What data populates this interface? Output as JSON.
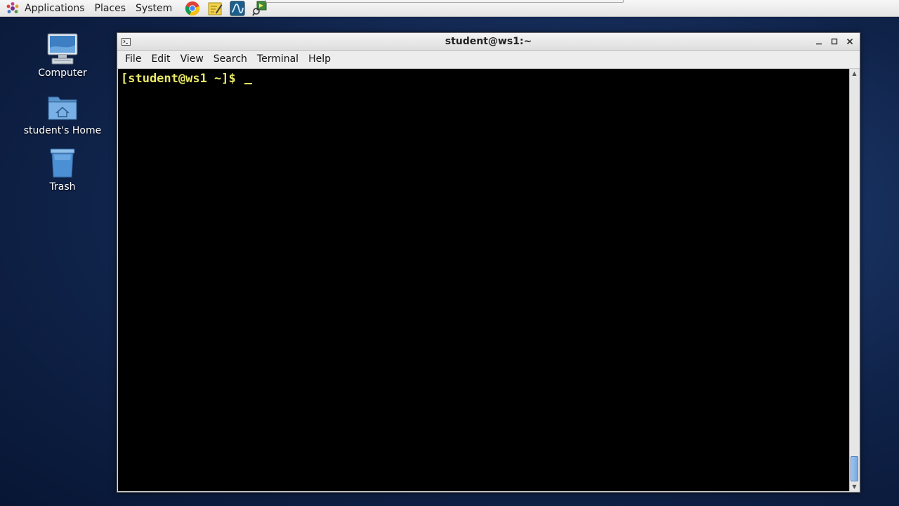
{
  "top_panel": {
    "menus": [
      "Applications",
      "Places",
      "System"
    ],
    "launchers": [
      "chrome-icon",
      "text-editor-icon",
      "oscilloscope-icon",
      "network-tool-icon"
    ]
  },
  "desktop": {
    "icons": [
      {
        "label": "Computer",
        "icon": "computer-icon"
      },
      {
        "label": "student's Home",
        "icon": "home-folder-icon"
      },
      {
        "label": "Trash",
        "icon": "trash-icon"
      }
    ]
  },
  "terminal": {
    "title": "student@ws1:~",
    "menu": [
      "File",
      "Edit",
      "View",
      "Search",
      "Terminal",
      "Help"
    ],
    "prompt": "[student@ws1 ~]$ ",
    "colors": {
      "background": "#000000",
      "prompt_text": "#e8e867"
    }
  }
}
